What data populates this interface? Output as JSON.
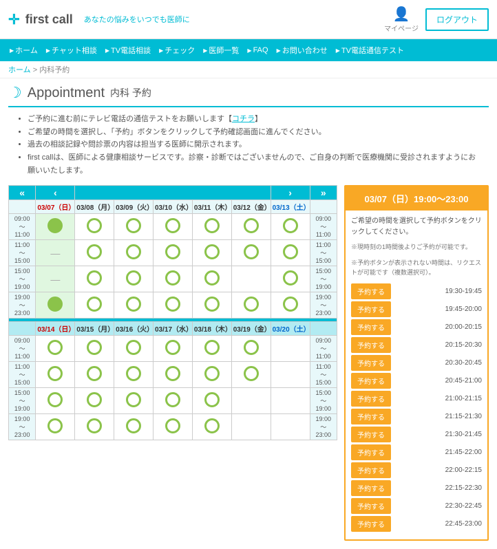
{
  "header": {
    "logo_text": "first call",
    "logo_tagline": "あなたの悩みをいつでも医師に",
    "mypage_label": "マイページ",
    "logout_label": "ログアウト"
  },
  "nav": {
    "items": [
      "ホーム",
      "チャット相談",
      "TV電話相談",
      "チェック",
      "医師一覧",
      "FAQ",
      "お問い合わせ",
      "TV電話通信テスト"
    ]
  },
  "breadcrumb": {
    "home": "ホーム",
    "current": "内科予約"
  },
  "page": {
    "icon": "🌙",
    "title": "Appointment",
    "subtitle": "内科 予約"
  },
  "info_items": [
    "ご予約に進む前にテレビ電話の通信テストをお願いします【コチラ】",
    "ご希望の時間を選択し、「予約」ボタンをクリックして予約確認画面に進んでください。",
    "過去の相談記録や問診票の内容は担当する医師に開示されます。",
    "first callは、医師による健康相談サービスです。診察・診断ではございませんので、ご自身の判断で医療機関に受診されますようにお願いいたします。"
  ],
  "calendar": {
    "week1": {
      "days": [
        "03/07（日）",
        "03/08（月）",
        "03/09（火）",
        "03/10（水）",
        "03/11（木）",
        "03/12（金）",
        "03/13（土）"
      ],
      "day_types": [
        "sun",
        "mon",
        "tue",
        "wed",
        "thu",
        "fri",
        "sat"
      ],
      "time_ranges": [
        "09:00〜11:00",
        "11:00〜15:00",
        "15:00〜19:00",
        "19:00〜23:00"
      ],
      "slots": [
        [
          "selected",
          "avail",
          "avail",
          "avail",
          "avail",
          "avail",
          "avail"
        ],
        [
          "dash",
          "avail",
          "avail",
          "avail",
          "avail",
          "avail",
          "avail"
        ],
        [
          "dash",
          "avail",
          "avail",
          "avail",
          "avail",
          "none",
          "avail"
        ],
        [
          "avail",
          "avail",
          "avail",
          "avail",
          "avail",
          "avail",
          "avail"
        ]
      ]
    },
    "week2": {
      "days": [
        "03/14（日）",
        "03/15（月）",
        "03/16（火）",
        "03/17（水）",
        "03/18（木）",
        "03/19（金）",
        "03/20（土）"
      ],
      "time_ranges": [
        "09:00〜11:00",
        "11:00〜15:00",
        "15:00〜19:00",
        "19:00〜23:00"
      ],
      "slots": [
        [
          "avail",
          "avail",
          "avail",
          "avail",
          "avail",
          "avail",
          "none"
        ],
        [
          "avail",
          "avail",
          "avail",
          "avail",
          "avail",
          "avail",
          "none"
        ],
        [
          "avail",
          "avail",
          "avail",
          "avail",
          "avail",
          "none",
          "none"
        ],
        [
          "avail",
          "avail",
          "avail",
          "avail",
          "avail",
          "none",
          "none"
        ]
      ]
    }
  },
  "right_panel": {
    "header": "03/07（日）19:00〜23:00",
    "desc": "ご希望の時間を選択して予約ボタンをクリックしてください。",
    "note1": "※現時刻の1時間後よりご予約が可能です。",
    "note2": "※予約ボタンが表示されない時間は、リクエストが可能です（複数選択可）。",
    "slots": [
      {
        "btn": "予約する",
        "time": "19:30-19:45",
        "type": "orange"
      },
      {
        "btn": "予約する",
        "time": "19:45-20:00",
        "type": "orange"
      },
      {
        "btn": "予約する",
        "time": "20:00-20:15",
        "type": "orange"
      },
      {
        "btn": "予約する",
        "time": "20:15-20:30",
        "type": "orange"
      },
      {
        "btn": "予約する",
        "time": "20:30-20:45",
        "type": "orange"
      },
      {
        "btn": "予約する",
        "time": "20:45-21:00",
        "type": "orange"
      },
      {
        "btn": "予約する",
        "time": "21:00-21:15",
        "type": "orange"
      },
      {
        "btn": "予約する",
        "time": "21:15-21:30",
        "type": "orange"
      },
      {
        "btn": "予約する",
        "time": "21:30-21:45",
        "type": "orange"
      },
      {
        "btn": "予約する",
        "time": "21:45-22:00",
        "type": "orange"
      },
      {
        "btn": "予約する",
        "time": "22:00-22:15",
        "type": "orange"
      },
      {
        "btn": "予約する",
        "time": "22:15-22:30",
        "type": "orange"
      },
      {
        "btn": "予約する",
        "time": "22:30-22:45",
        "type": "orange"
      },
      {
        "btn": "予約する",
        "time": "22:45-23:00",
        "type": "orange"
      }
    ]
  }
}
